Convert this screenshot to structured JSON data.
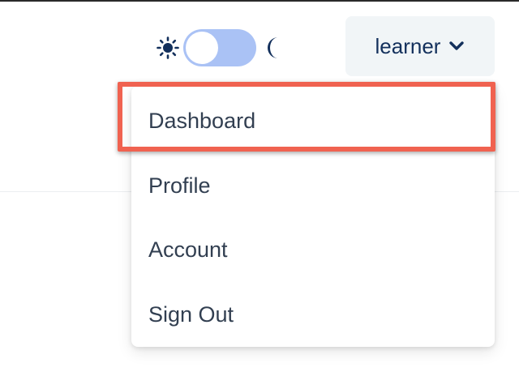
{
  "header": {
    "theme_toggle": {
      "left_icon": "sun-icon",
      "right_icon": "moon-icon",
      "mode": "light"
    },
    "user_menu": {
      "username": "learner",
      "icon": "chevron-down-icon",
      "expanded": true
    }
  },
  "dropdown": {
    "items": [
      {
        "label": "Dashboard",
        "highlighted": true
      },
      {
        "label": "Profile"
      },
      {
        "label": "Account"
      },
      {
        "label": "Sign Out"
      }
    ]
  },
  "colors": {
    "toggle_track": "#aac2f5",
    "icon_navy": "#13305c",
    "button_bg": "#f1f5f7",
    "highlight": "#f06250",
    "menu_text": "#323f51"
  }
}
